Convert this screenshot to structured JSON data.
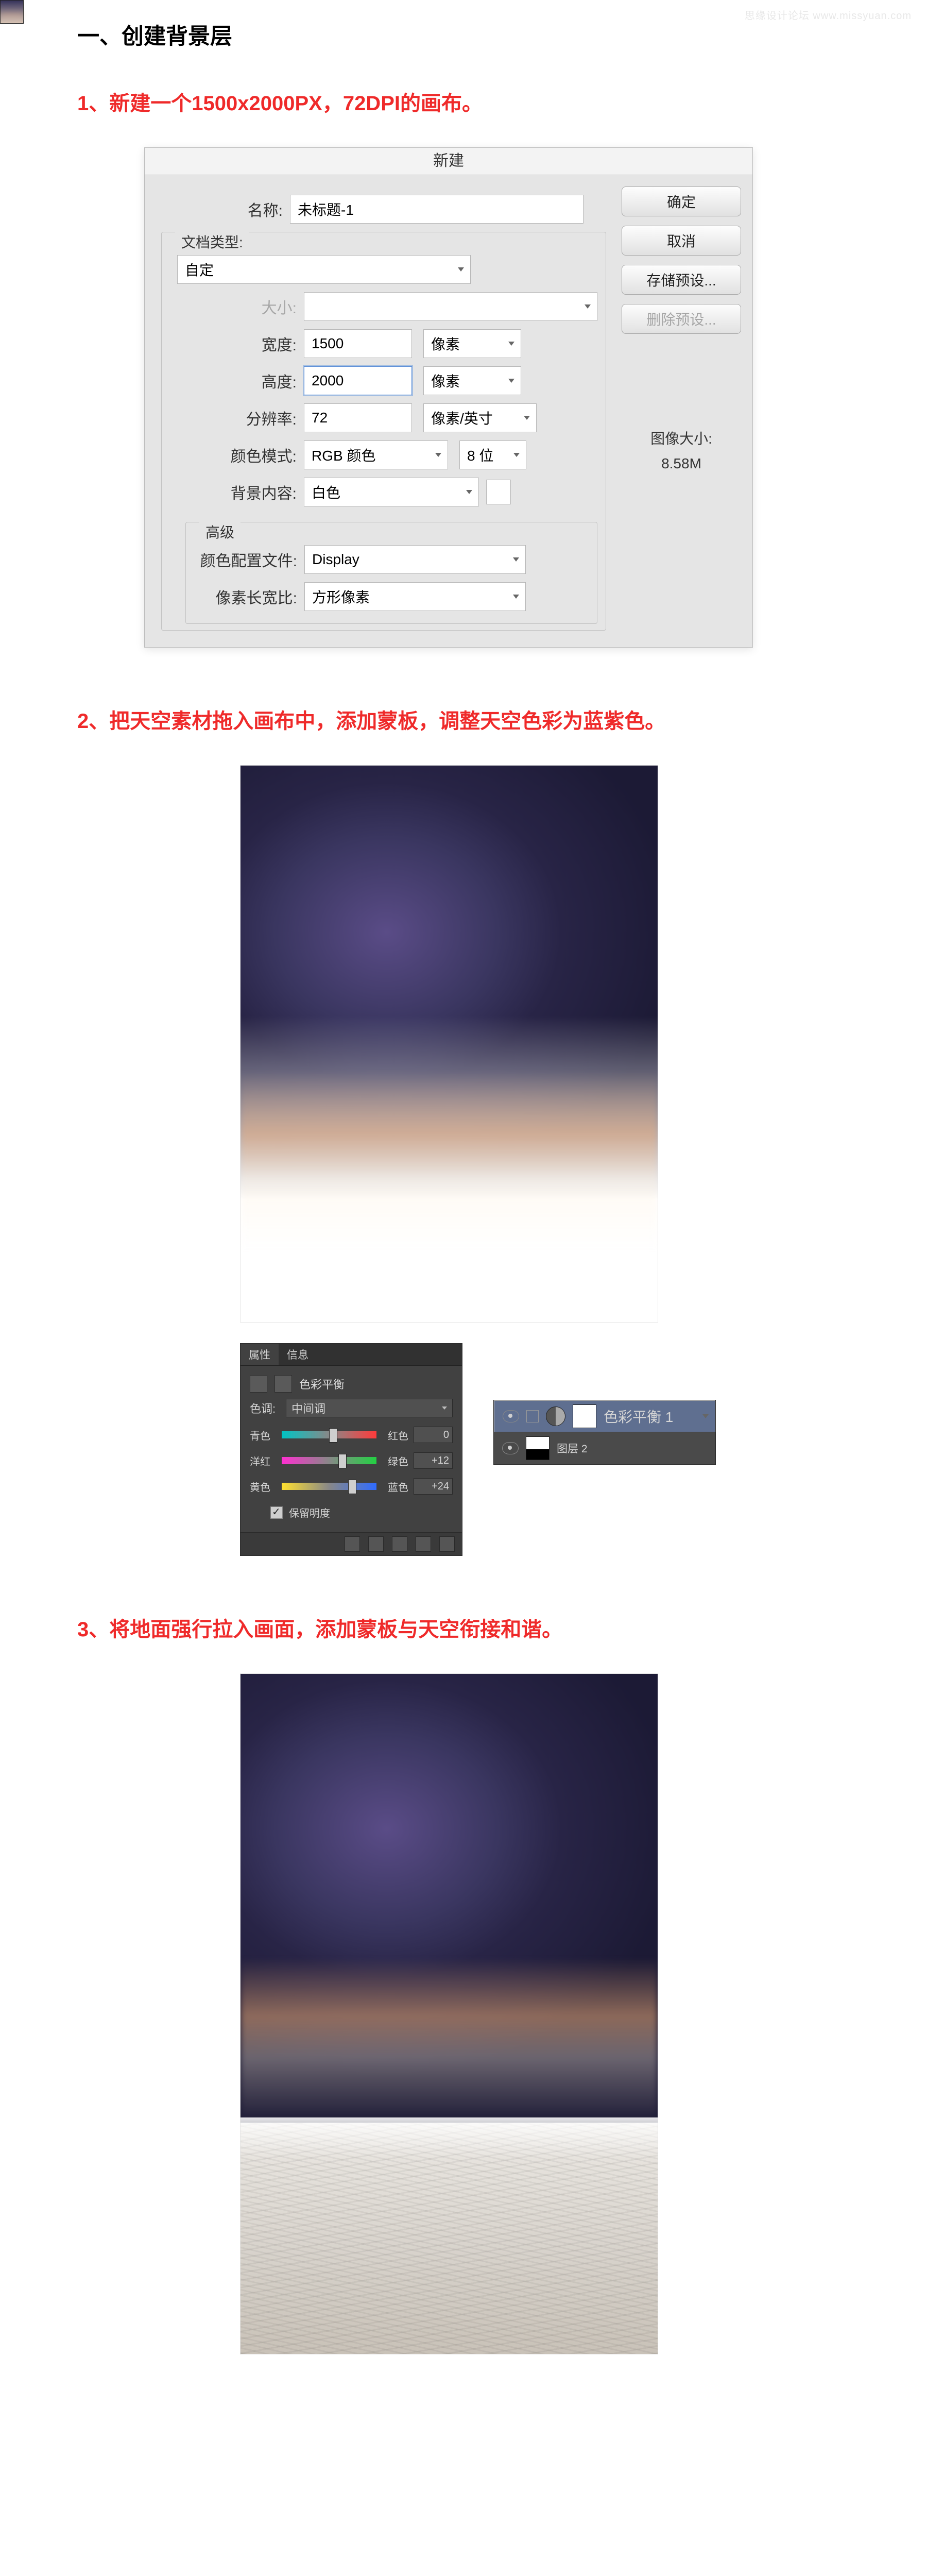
{
  "watermark": "思缘设计论坛  www.missyuan.com",
  "section_title": "一、创建背景层",
  "steps": {
    "s1": "1、新建一个1500x2000PX，72DPI的画布。",
    "s2": "2、把天空素材拖入画布中，添加蒙板，调整天空色彩为蓝紫色。",
    "s3": "3、将地面强行拉入画面，添加蒙板与天空衔接和谐。"
  },
  "dialog": {
    "title": "新建",
    "labels": {
      "name": "名称:",
      "doc_type": "文档类型:",
      "size": "大小:",
      "width": "宽度:",
      "height": "高度:",
      "res": "分辨率:",
      "color_mode": "颜色模式:",
      "bg": "背景内容:",
      "adv": "高级",
      "profile": "颜色配置文件:",
      "aspect": "像素长宽比:"
    },
    "values": {
      "name": "未标题-1",
      "doc_type": "自定",
      "size": "",
      "width": "1500",
      "height": "2000",
      "res": "72",
      "unit_px": "像素",
      "unit_ppi": "像素/英寸",
      "color_mode": "RGB 颜色",
      "bits": "8 位",
      "bg": "白色",
      "profile": "Display",
      "aspect": "方形像素"
    },
    "buttons": {
      "ok": "确定",
      "cancel": "取消",
      "save_preset": "存储预设...",
      "delete_preset": "删除预设..."
    },
    "img_size_label": "图像大小:",
    "img_size_value": "8.58M"
  },
  "props_panel": {
    "tab_active": "属性",
    "tab_other": "信息",
    "adj_name": "色彩平衡",
    "tone_label": "色调:",
    "tone_value": "中间调",
    "sliders": [
      {
        "l": "青色",
        "r": "红色",
        "v": "0",
        "pos": 50,
        "grad": "grad1"
      },
      {
        "l": "洋红",
        "r": "绿色",
        "v": "+12",
        "pos": 60,
        "grad": "grad2"
      },
      {
        "l": "黄色",
        "r": "蓝色",
        "v": "+24",
        "pos": 70,
        "grad": "grad3"
      }
    ],
    "preserve": "保留明度"
  },
  "layers": {
    "adj_name": "色彩平衡 1",
    "sky_name": "图层 2"
  }
}
